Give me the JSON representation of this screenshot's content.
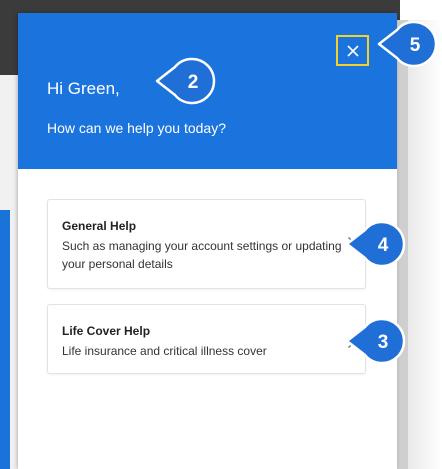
{
  "panel": {
    "greeting": "Hi Green,",
    "subtitle": "How can we help you today?",
    "close_icon": "close-icon"
  },
  "help_options": [
    {
      "title": "General Help",
      "description": "Such as managing your account settings or updating your personal details"
    },
    {
      "title": "Life Cover Help",
      "description": "Life insurance and critical illness cover"
    }
  ],
  "callouts": {
    "greeting_marker": "2",
    "life_cover_marker": "3",
    "general_help_marker": "4",
    "close_marker": "5"
  },
  "colors": {
    "header_blue": "#1b74de",
    "callout_blue": "#1f6fd6",
    "close_highlight": "#f2d22a"
  }
}
